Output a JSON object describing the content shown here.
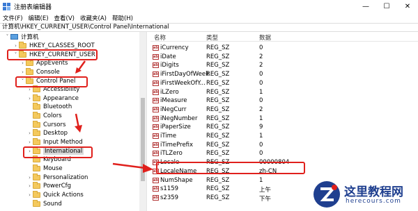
{
  "window": {
    "title": "注册表编辑器",
    "min": "—",
    "max": "☐",
    "close": "✕"
  },
  "menu": [
    "文件(F)",
    "编辑(E)",
    "查看(V)",
    "收藏夹(A)",
    "帮助(H)"
  ],
  "address": "计算机\\HKEY_CURRENT_USER\\Control Panel\\International",
  "tree": [
    {
      "label": "计算机",
      "arrow": "˅",
      "kind": "pc"
    },
    {
      "label": "HKEY_CLASSES_ROOT",
      "arrow": "›",
      "kind": "folder"
    },
    {
      "label": "HKEY_CURRENT_USER",
      "arrow": "˅",
      "kind": "folder"
    },
    {
      "label": "AppEvents",
      "arrow": "›",
      "kind": "folder"
    },
    {
      "label": "Console",
      "arrow": "›",
      "kind": "folder"
    },
    {
      "label": "Control Panel",
      "arrow": "˅",
      "kind": "folder"
    },
    {
      "label": "Accessibility",
      "arrow": "›",
      "kind": "folder"
    },
    {
      "label": "Appearance",
      "arrow": "›",
      "kind": "folder"
    },
    {
      "label": "Bluetooth",
      "arrow": "",
      "kind": "folder"
    },
    {
      "label": "Colors",
      "arrow": "",
      "kind": "folder"
    },
    {
      "label": "Cursors",
      "arrow": "",
      "kind": "folder"
    },
    {
      "label": "Desktop",
      "arrow": "›",
      "kind": "folder"
    },
    {
      "label": "Input Method",
      "arrow": "›",
      "kind": "folder"
    },
    {
      "label": "International",
      "arrow": "›",
      "kind": "folder",
      "selected": true
    },
    {
      "label": "Keyboard",
      "arrow": "",
      "kind": "folder"
    },
    {
      "label": "Mouse",
      "arrow": "",
      "kind": "folder"
    },
    {
      "label": "Personalization",
      "arrow": "›",
      "kind": "folder"
    },
    {
      "label": "PowerCfg",
      "arrow": "›",
      "kind": "folder"
    },
    {
      "label": "Quick Actions",
      "arrow": "›",
      "kind": "folder"
    },
    {
      "label": "Sound",
      "arrow": "",
      "kind": "folder"
    }
  ],
  "columns": {
    "name": "名称",
    "type": "类型",
    "data": "数据"
  },
  "values": [
    {
      "name": "iCurrency",
      "type": "REG_SZ",
      "data": "0"
    },
    {
      "name": "iDate",
      "type": "REG_SZ",
      "data": "2"
    },
    {
      "name": "iDigits",
      "type": "REG_SZ",
      "data": "2"
    },
    {
      "name": "iFirstDayOfWeek",
      "type": "REG_SZ",
      "data": "0"
    },
    {
      "name": "iFirstWeekOfY...",
      "type": "REG_SZ",
      "data": "0"
    },
    {
      "name": "iLZero",
      "type": "REG_SZ",
      "data": "1"
    },
    {
      "name": "iMeasure",
      "type": "REG_SZ",
      "data": "0"
    },
    {
      "name": "iNegCurr",
      "type": "REG_SZ",
      "data": "2"
    },
    {
      "name": "iNegNumber",
      "type": "REG_SZ",
      "data": "1"
    },
    {
      "name": "iPaperSize",
      "type": "REG_SZ",
      "data": "9"
    },
    {
      "name": "iTime",
      "type": "REG_SZ",
      "data": "1"
    },
    {
      "name": "iTimePrefix",
      "type": "REG_SZ",
      "data": "0"
    },
    {
      "name": "iTLZero",
      "type": "REG_SZ",
      "data": "0"
    },
    {
      "name": "Locale",
      "type": "REG_SZ",
      "data": "00000804",
      "selected": true
    },
    {
      "name": "LocaleName",
      "type": "REG_SZ",
      "data": "zh-CN"
    },
    {
      "name": "NumShape",
      "type": "REG_SZ",
      "data": "1"
    },
    {
      "name": "s1159",
      "type": "REG_SZ",
      "data": "上午"
    },
    {
      "name": "s2359",
      "type": "REG_SZ",
      "data": "下午"
    }
  ],
  "value_icon": "ab",
  "watermark": {
    "title": "这里教程网",
    "subtitle": "herecours.com"
  },
  "colors": {
    "annotation": "#e0201c",
    "folder": "#f4c95d",
    "logo": "#1f3f8f"
  }
}
